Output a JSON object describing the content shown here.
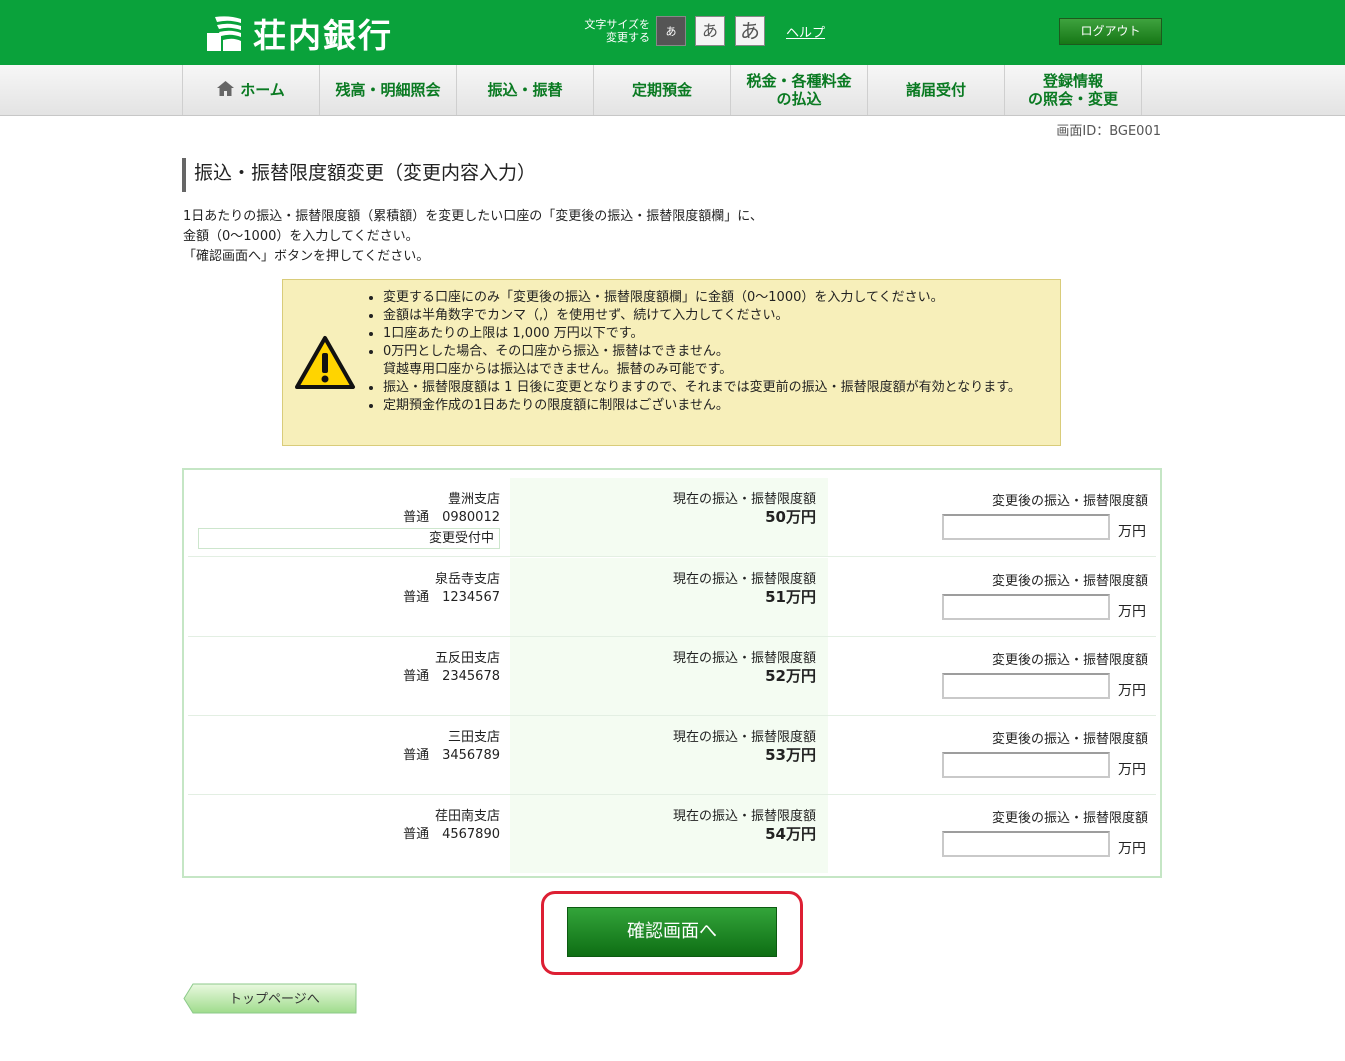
{
  "header": {
    "bank_name": "荘内銀行",
    "font_size_label_line1": "文字サイズを",
    "font_size_label_line2": "変更する",
    "font_small": "あ",
    "font_medium": "あ",
    "font_large": "あ",
    "help": "ヘルプ",
    "logout": "ログアウト",
    "brand_color": "#0aa23b"
  },
  "nav": {
    "items": [
      {
        "label": "ホーム",
        "icon": "home-icon"
      },
      {
        "label": "残高・明細照会"
      },
      {
        "label": "振込・振替"
      },
      {
        "label": "定期預金"
      },
      {
        "label_line1": "税金・各種料金",
        "label_line2": "の払込"
      },
      {
        "label": "諸届受付"
      },
      {
        "label_line1": "登録情報",
        "label_line2": "の照会・変更"
      }
    ]
  },
  "screen_id": "画面ID：BGE001",
  "page": {
    "title": "振込・振替限度額変更（変更内容入力）",
    "intro_line1": "1日あたりの振込・振替限度額（累積額）を変更したい口座の「変更後の振込・振替限度額欄」に、",
    "intro_line2": "金額（0～1000）を入力してください。",
    "intro_line3": "「確認画面へ」ボタンを押してください。"
  },
  "notice": {
    "items": [
      "変更する口座にのみ「変更後の振込・振替限度額欄」に金額（0～1000）を入力してください。",
      "金額は半角数字でカンマ（,）を使用せず、続けて入力してください。",
      "1口座あたりの上限は 1,000 万円以下です。",
      "0万円とした場合、その口座から振込・振替はできません。",
      "貸越専用口座からは振込はできません。振替のみ可能です。",
      "振込・振替限度額は 1 日後に変更となりますので、それまでは変更前の振込・振替限度額が有効となります。",
      "定期預金作成の1日あたりの限度額に制限はございません。"
    ]
  },
  "table": {
    "current_label": "現在の振込・振替限度額",
    "new_label": "変更後の振込・振替限度額",
    "unit": "万円",
    "rows": [
      {
        "branch": "豊洲支店",
        "account": "普通　0980012",
        "status": "変更受付中",
        "current": "50万円",
        "new_value": ""
      },
      {
        "branch": "泉岳寺支店",
        "account": "普通　1234567",
        "current": "51万円",
        "new_value": ""
      },
      {
        "branch": "五反田支店",
        "account": "普通　2345678",
        "current": "52万円",
        "new_value": ""
      },
      {
        "branch": "三田支店",
        "account": "普通　3456789",
        "current": "53万円",
        "new_value": ""
      },
      {
        "branch": "荏田南支店",
        "account": "普通　4567890",
        "current": "54万円",
        "new_value": ""
      }
    ]
  },
  "buttons": {
    "confirm": "確認画面へ",
    "top_page": "トップページへ"
  }
}
